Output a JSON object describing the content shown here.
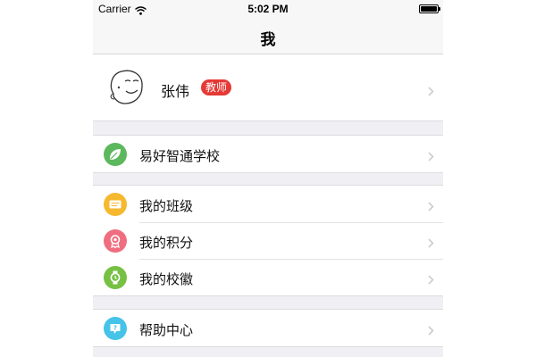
{
  "status_bar": {
    "carrier": "Carrier",
    "time": "5:02 PM",
    "wifi_icon": "wifi-icon",
    "battery_icon": "battery-full-icon"
  },
  "nav": {
    "title": "我"
  },
  "profile": {
    "name": "张伟",
    "role": "教师",
    "role_color": "#e53935"
  },
  "groups": [
    {
      "items": [
        {
          "label": "易好智通学校",
          "icon": "leaf-icon",
          "color": "#5cb85c"
        }
      ]
    },
    {
      "items": [
        {
          "label": "我的班级",
          "icon": "class-card-icon",
          "color": "#f5b82e"
        },
        {
          "label": "我的积分",
          "icon": "medal-icon",
          "color": "#ef6d7f"
        },
        {
          "label": "我的校徽",
          "icon": "badge-watch-icon",
          "color": "#76c043"
        }
      ]
    },
    {
      "items": [
        {
          "label": "帮助中心",
          "icon": "help-icon",
          "color": "#45c3e8"
        }
      ]
    }
  ]
}
